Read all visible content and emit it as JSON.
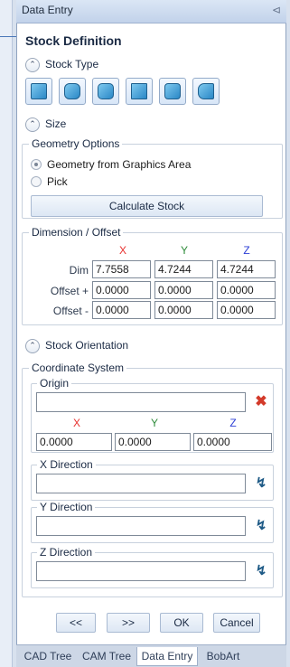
{
  "window": {
    "title": "Data Entry",
    "pin_glyph": "⊲"
  },
  "panel": {
    "heading": "Stock Definition"
  },
  "stock_type": {
    "label": "Stock Type",
    "tools": [
      "block-stock-icon",
      "cylinder-stock-icon",
      "rounded-block-stock-icon",
      "extrusion-stock-icon",
      "hex-stock-icon",
      "revolve-stock-icon"
    ]
  },
  "size": {
    "label": "Size"
  },
  "geometry": {
    "group_label": "Geometry Options",
    "opt_graphics": "Geometry from Graphics Area",
    "opt_pick": "Pick",
    "selected": "Geometry from Graphics Area",
    "calc_label": "Calculate Stock"
  },
  "dimension": {
    "group_label": "Dimension / Offset",
    "axes": [
      "X",
      "Y",
      "Z"
    ],
    "rows": [
      {
        "label": "Dim",
        "values": [
          "7.7558",
          "4.7244",
          "4.7244"
        ]
      },
      {
        "label": "Offset +",
        "values": [
          "0.0000",
          "0.0000",
          "0.0000"
        ]
      },
      {
        "label": "Offset -",
        "values": [
          "0.0000",
          "0.0000",
          "0.0000"
        ]
      }
    ]
  },
  "orientation": {
    "label": "Stock Orientation",
    "coord_label": "Coordinate System",
    "origin_label": "Origin",
    "origin_value": "",
    "axes": [
      "X",
      "Y",
      "Z"
    ],
    "origin_xyz": [
      "0.0000",
      "0.0000",
      "0.0000"
    ],
    "x_dir_label": "X Direction",
    "y_dir_label": "Y Direction",
    "z_dir_label": "Z Direction",
    "x_dir_value": "",
    "y_dir_value": "",
    "z_dir_value": ""
  },
  "buttons": {
    "prev": "<<",
    "next": ">>",
    "ok": "OK",
    "cancel": "Cancel"
  },
  "tabs": [
    "CAD Tree",
    "CAM Tree",
    "Data Entry",
    "BobArt"
  ],
  "active_tab": "Data Entry",
  "colors": {
    "x": "#e8302e",
    "y": "#2e8b3a",
    "z": "#2c3fd6",
    "clear": "#d33a2a",
    "pick": "#1e5a86"
  }
}
